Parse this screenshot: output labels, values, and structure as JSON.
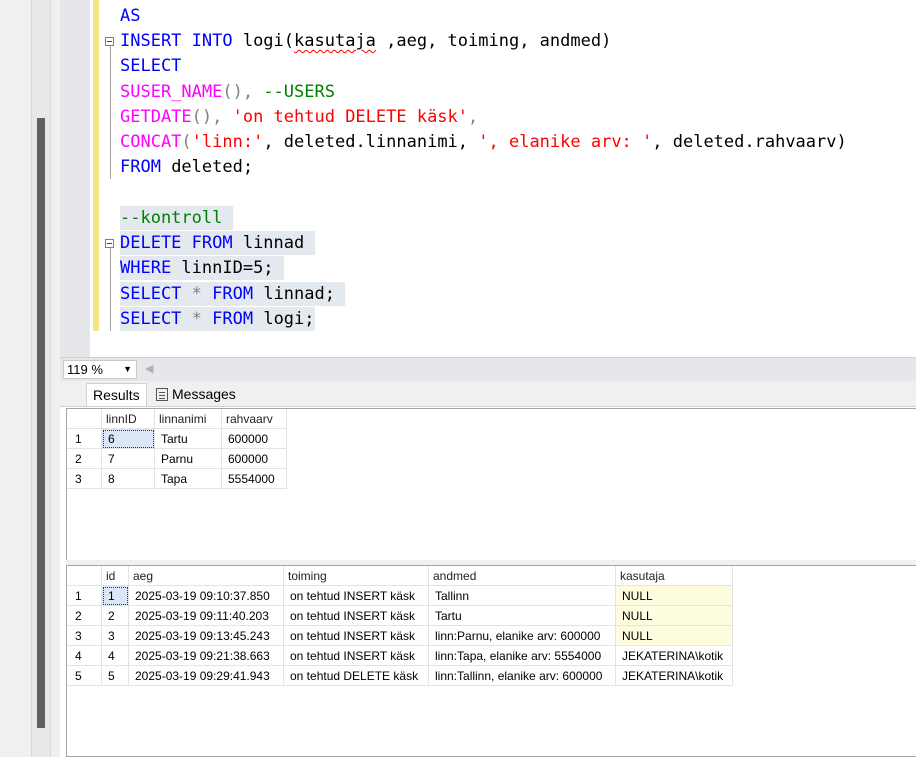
{
  "editor": {
    "lines": {
      "l1": "AS",
      "l2_kw1": "INSERT INTO",
      "l2_tbl": " logi(",
      "l2_col1": "kasutaja",
      "l2_rest": " ,aeg, toiming, andmed)",
      "l3": "SELECT",
      "l4_fn": "SUSER_NAME",
      "l4_paren": "(), ",
      "l4_cmt": "--USERS",
      "l5_fn": "GETDATE",
      "l5_paren": "(), ",
      "l5_str": "'on tehtud DELETE käsk'",
      "l5_end": ",",
      "l6_fn": "CONCAT",
      "l6_p1": "(",
      "l6_s1": "'linn:'",
      "l6_m1": ", deleted.linnanimi, ",
      "l6_s2": "', elanike arv: '",
      "l6_m2": ", deleted.rahvaarv)",
      "l7_kw": "FROM",
      "l7_rest": " deleted;",
      "l9": "--kontroll",
      "l10_kw": "DELETE FROM",
      "l10_rest": " linnad",
      "l11_kw": "WHERE",
      "l11_rest": " linnID=5;",
      "l12_kw1": "SELECT",
      "l12_star": " * ",
      "l12_kw2": "FROM",
      "l12_rest": " linnad;",
      "l13_kw1": "SELECT",
      "l13_star": " * ",
      "l13_kw2": "FROM",
      "l13_rest": " logi;"
    }
  },
  "zoom": {
    "value": "119 %"
  },
  "tabs": {
    "results": "Results",
    "messages": "Messages"
  },
  "grid1": {
    "headers": [
      "linnID",
      "linnanimi",
      "rahvaarv"
    ],
    "rows": [
      {
        "n": "1",
        "linnID": "6",
        "linnanimi": "Tartu",
        "rahvaarv": "600000"
      },
      {
        "n": "2",
        "linnID": "7",
        "linnanimi": "Parnu",
        "rahvaarv": "600000"
      },
      {
        "n": "3",
        "linnID": "8",
        "linnanimi": "Tapa",
        "rahvaarv": "5554000"
      }
    ]
  },
  "grid2": {
    "headers": [
      "id",
      "aeg",
      "toiming",
      "andmed",
      "kasutaja"
    ],
    "rows": [
      {
        "n": "1",
        "id": "1",
        "aeg": "2025-03-19 09:10:37.850",
        "toiming": "on tehtud INSERT käsk",
        "andmed": "Tallinn",
        "kasutaja": "NULL"
      },
      {
        "n": "2",
        "id": "2",
        "aeg": "2025-03-19 09:11:40.203",
        "toiming": "on tehtud INSERT käsk",
        "andmed": "Tartu",
        "kasutaja": "NULL"
      },
      {
        "n": "3",
        "id": "3",
        "aeg": "2025-03-19 09:13:45.243",
        "toiming": "on tehtud INSERT käsk",
        "andmed": "linn:Parnu, elanike arv: 600000",
        "kasutaja": "NULL"
      },
      {
        "n": "4",
        "id": "4",
        "aeg": "2025-03-19 09:21:38.663",
        "toiming": "on tehtud INSERT käsk",
        "andmed": "linn:Tapa, elanike arv: 5554000",
        "kasutaja": "JEKATERINA\\kotik"
      },
      {
        "n": "5",
        "id": "5",
        "aeg": "2025-03-19 09:29:41.943",
        "toiming": "on tehtud DELETE käsk",
        "andmed": "linn:Tallinn, elanike arv: 600000",
        "kasutaja": "JEKATERINA\\kotik"
      }
    ]
  }
}
